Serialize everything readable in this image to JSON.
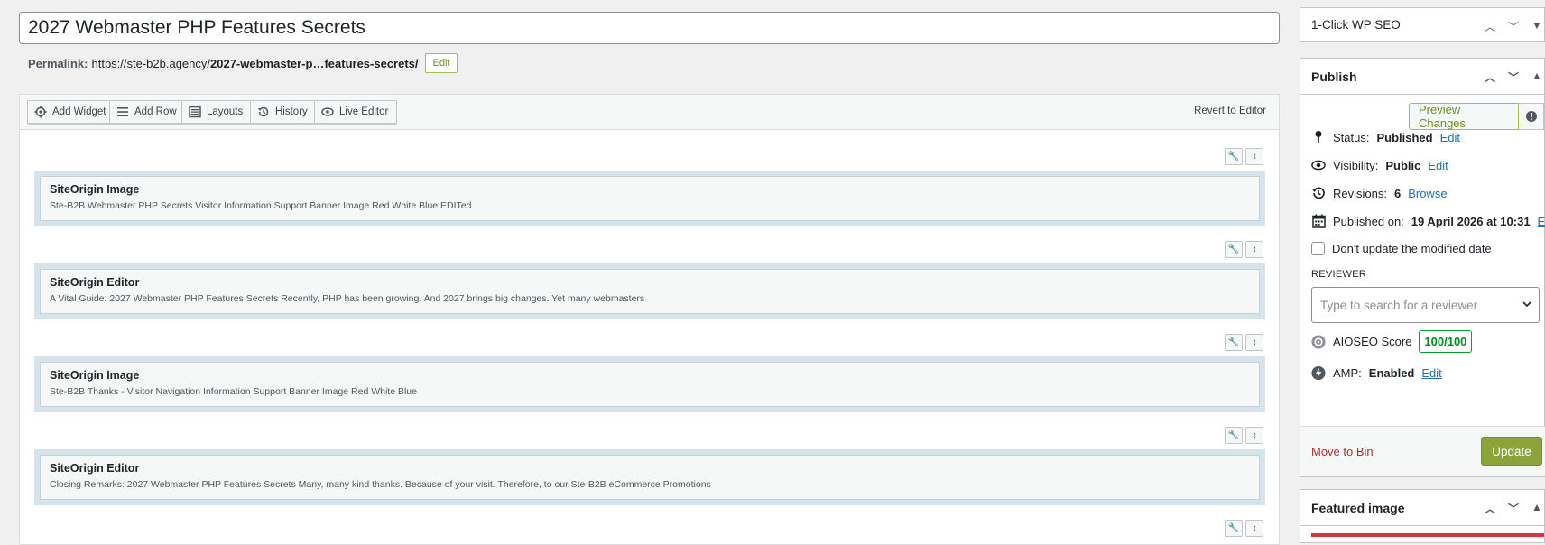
{
  "post": {
    "title": "2027 Webmaster PHP Features Secrets",
    "permalink_label": "Permalink:",
    "permalink_base": "https://ste-b2b.agency/",
    "permalink_slug": "2027-webmaster-p…features-secrets/",
    "permalink_edit": "Edit"
  },
  "toolbar": {
    "add_widget": "Add Widget",
    "add_row": "Add Row",
    "layouts": "Layouts",
    "history": "History",
    "live_editor": "Live Editor",
    "revert": "Revert to Editor"
  },
  "widgets": [
    {
      "title": "SiteOrigin Image",
      "desc": "Ste-B2B Webmaster PHP Secrets Visitor Information Support Banner Image Red White Blue EDITed"
    },
    {
      "title": "SiteOrigin Editor",
      "desc": "A Vital Guide: 2027 Webmaster PHP Features Secrets Recently, PHP has been growing. And 2027 brings big changes. Yet many webmasters"
    },
    {
      "title": "SiteOrigin Image",
      "desc": "Ste-B2B Thanks - Visitor Navigation Information Support Banner Image Red White Blue"
    },
    {
      "title": "SiteOrigin Editor",
      "desc": "Closing Remarks: 2027 Webmaster PHP Features Secrets Many, many kind thanks. Because of your visit. Therefore, to our Ste-B2B eCommerce Promotions"
    }
  ],
  "sidebar": {
    "seo_title": "1-Click WP SEO",
    "publish_title": "Publish",
    "preview_changes": "Preview Changes",
    "status_label": "Status:",
    "status_value": "Published",
    "visibility_label": "Visibility:",
    "visibility_value": "Public",
    "revisions_label": "Revisions:",
    "revisions_value": "6",
    "revisions_link": "Browse",
    "published_label": "Published on:",
    "published_value": "19 April 2026 at 10:31",
    "edit": "Edit",
    "dont_update": "Don't update the modified date",
    "reviewer_label": "REVIEWER",
    "reviewer_placeholder": "Type to search for a reviewer",
    "aioseo_label": "AIOSEO Score",
    "aioseo_score": "100/100",
    "amp_label": "AMP:",
    "amp_value": "Enabled",
    "move_to_bin": "Move to Bin",
    "update": "Update",
    "featured_title": "Featured image"
  }
}
